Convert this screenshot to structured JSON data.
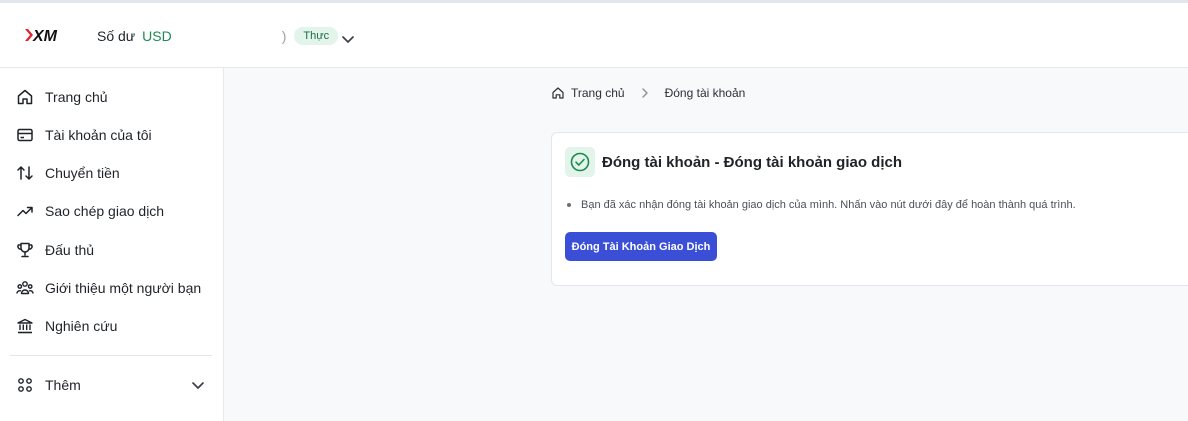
{
  "header": {
    "balance_label": "Số dư",
    "currency": "USD",
    "paren": ")",
    "account_type_badge": "Thực"
  },
  "sidebar": {
    "items": [
      {
        "label": "Trang chủ",
        "icon": "home-icon"
      },
      {
        "label": "Tài khoản của tôi",
        "icon": "card-icon"
      },
      {
        "label": "Chuyển tiền",
        "icon": "transfer-icon"
      },
      {
        "label": "Sao chép giao dịch",
        "icon": "trend-icon"
      },
      {
        "label": "Đấu thủ",
        "icon": "trophy-icon"
      },
      {
        "label": "Giới thiệu một người bạn",
        "icon": "people-icon"
      },
      {
        "label": "Nghiên cứu",
        "icon": "bank-icon"
      }
    ],
    "more_label": "Thêm"
  },
  "breadcrumb": {
    "home": "Trang chủ",
    "current": "Đóng tài khoản"
  },
  "card": {
    "title": "Đóng tài khoản - Đóng tài khoản giao dịch",
    "message": "Bạn đã xác nhận đóng tài khoản giao dịch của mình. Nhấn vào nút dưới đây để hoàn thành quá trình.",
    "button_label": "Đóng Tài Khoản Giao Dịch"
  },
  "colors": {
    "accent": "#3b4fd6",
    "success": "#1e8a52",
    "brand_red": "#e0262b"
  }
}
